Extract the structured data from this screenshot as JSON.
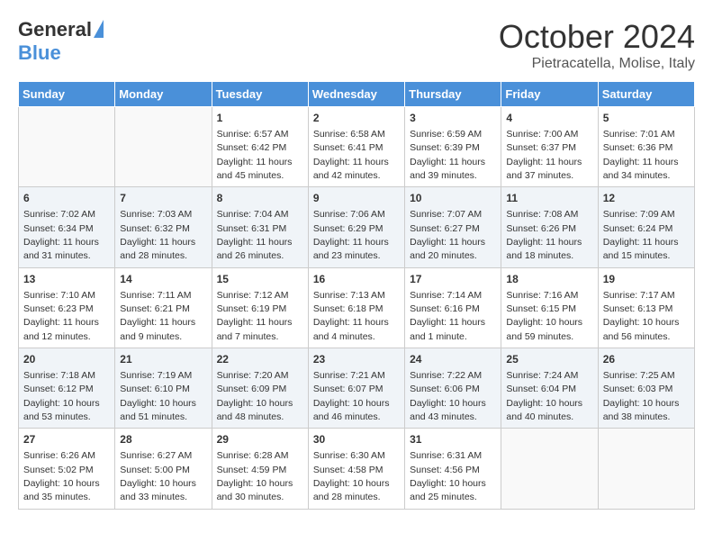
{
  "header": {
    "logo_general": "General",
    "logo_blue": "Blue",
    "month": "October 2024",
    "location": "Pietracatella, Molise, Italy"
  },
  "weekdays": [
    "Sunday",
    "Monday",
    "Tuesday",
    "Wednesday",
    "Thursday",
    "Friday",
    "Saturday"
  ],
  "weeks": [
    [
      {
        "day": "",
        "info": ""
      },
      {
        "day": "",
        "info": ""
      },
      {
        "day": "1",
        "info": "Sunrise: 6:57 AM\nSunset: 6:42 PM\nDaylight: 11 hours and 45 minutes."
      },
      {
        "day": "2",
        "info": "Sunrise: 6:58 AM\nSunset: 6:41 PM\nDaylight: 11 hours and 42 minutes."
      },
      {
        "day": "3",
        "info": "Sunrise: 6:59 AM\nSunset: 6:39 PM\nDaylight: 11 hours and 39 minutes."
      },
      {
        "day": "4",
        "info": "Sunrise: 7:00 AM\nSunset: 6:37 PM\nDaylight: 11 hours and 37 minutes."
      },
      {
        "day": "5",
        "info": "Sunrise: 7:01 AM\nSunset: 6:36 PM\nDaylight: 11 hours and 34 minutes."
      }
    ],
    [
      {
        "day": "6",
        "info": "Sunrise: 7:02 AM\nSunset: 6:34 PM\nDaylight: 11 hours and 31 minutes."
      },
      {
        "day": "7",
        "info": "Sunrise: 7:03 AM\nSunset: 6:32 PM\nDaylight: 11 hours and 28 minutes."
      },
      {
        "day": "8",
        "info": "Sunrise: 7:04 AM\nSunset: 6:31 PM\nDaylight: 11 hours and 26 minutes."
      },
      {
        "day": "9",
        "info": "Sunrise: 7:06 AM\nSunset: 6:29 PM\nDaylight: 11 hours and 23 minutes."
      },
      {
        "day": "10",
        "info": "Sunrise: 7:07 AM\nSunset: 6:27 PM\nDaylight: 11 hours and 20 minutes."
      },
      {
        "day": "11",
        "info": "Sunrise: 7:08 AM\nSunset: 6:26 PM\nDaylight: 11 hours and 18 minutes."
      },
      {
        "day": "12",
        "info": "Sunrise: 7:09 AM\nSunset: 6:24 PM\nDaylight: 11 hours and 15 minutes."
      }
    ],
    [
      {
        "day": "13",
        "info": "Sunrise: 7:10 AM\nSunset: 6:23 PM\nDaylight: 11 hours and 12 minutes."
      },
      {
        "day": "14",
        "info": "Sunrise: 7:11 AM\nSunset: 6:21 PM\nDaylight: 11 hours and 9 minutes."
      },
      {
        "day": "15",
        "info": "Sunrise: 7:12 AM\nSunset: 6:19 PM\nDaylight: 11 hours and 7 minutes."
      },
      {
        "day": "16",
        "info": "Sunrise: 7:13 AM\nSunset: 6:18 PM\nDaylight: 11 hours and 4 minutes."
      },
      {
        "day": "17",
        "info": "Sunrise: 7:14 AM\nSunset: 6:16 PM\nDaylight: 11 hours and 1 minute."
      },
      {
        "day": "18",
        "info": "Sunrise: 7:16 AM\nSunset: 6:15 PM\nDaylight: 10 hours and 59 minutes."
      },
      {
        "day": "19",
        "info": "Sunrise: 7:17 AM\nSunset: 6:13 PM\nDaylight: 10 hours and 56 minutes."
      }
    ],
    [
      {
        "day": "20",
        "info": "Sunrise: 7:18 AM\nSunset: 6:12 PM\nDaylight: 10 hours and 53 minutes."
      },
      {
        "day": "21",
        "info": "Sunrise: 7:19 AM\nSunset: 6:10 PM\nDaylight: 10 hours and 51 minutes."
      },
      {
        "day": "22",
        "info": "Sunrise: 7:20 AM\nSunset: 6:09 PM\nDaylight: 10 hours and 48 minutes."
      },
      {
        "day": "23",
        "info": "Sunrise: 7:21 AM\nSunset: 6:07 PM\nDaylight: 10 hours and 46 minutes."
      },
      {
        "day": "24",
        "info": "Sunrise: 7:22 AM\nSunset: 6:06 PM\nDaylight: 10 hours and 43 minutes."
      },
      {
        "day": "25",
        "info": "Sunrise: 7:24 AM\nSunset: 6:04 PM\nDaylight: 10 hours and 40 minutes."
      },
      {
        "day": "26",
        "info": "Sunrise: 7:25 AM\nSunset: 6:03 PM\nDaylight: 10 hours and 38 minutes."
      }
    ],
    [
      {
        "day": "27",
        "info": "Sunrise: 6:26 AM\nSunset: 5:02 PM\nDaylight: 10 hours and 35 minutes."
      },
      {
        "day": "28",
        "info": "Sunrise: 6:27 AM\nSunset: 5:00 PM\nDaylight: 10 hours and 33 minutes."
      },
      {
        "day": "29",
        "info": "Sunrise: 6:28 AM\nSunset: 4:59 PM\nDaylight: 10 hours and 30 minutes."
      },
      {
        "day": "30",
        "info": "Sunrise: 6:30 AM\nSunset: 4:58 PM\nDaylight: 10 hours and 28 minutes."
      },
      {
        "day": "31",
        "info": "Sunrise: 6:31 AM\nSunset: 4:56 PM\nDaylight: 10 hours and 25 minutes."
      },
      {
        "day": "",
        "info": ""
      },
      {
        "day": "",
        "info": ""
      }
    ]
  ]
}
